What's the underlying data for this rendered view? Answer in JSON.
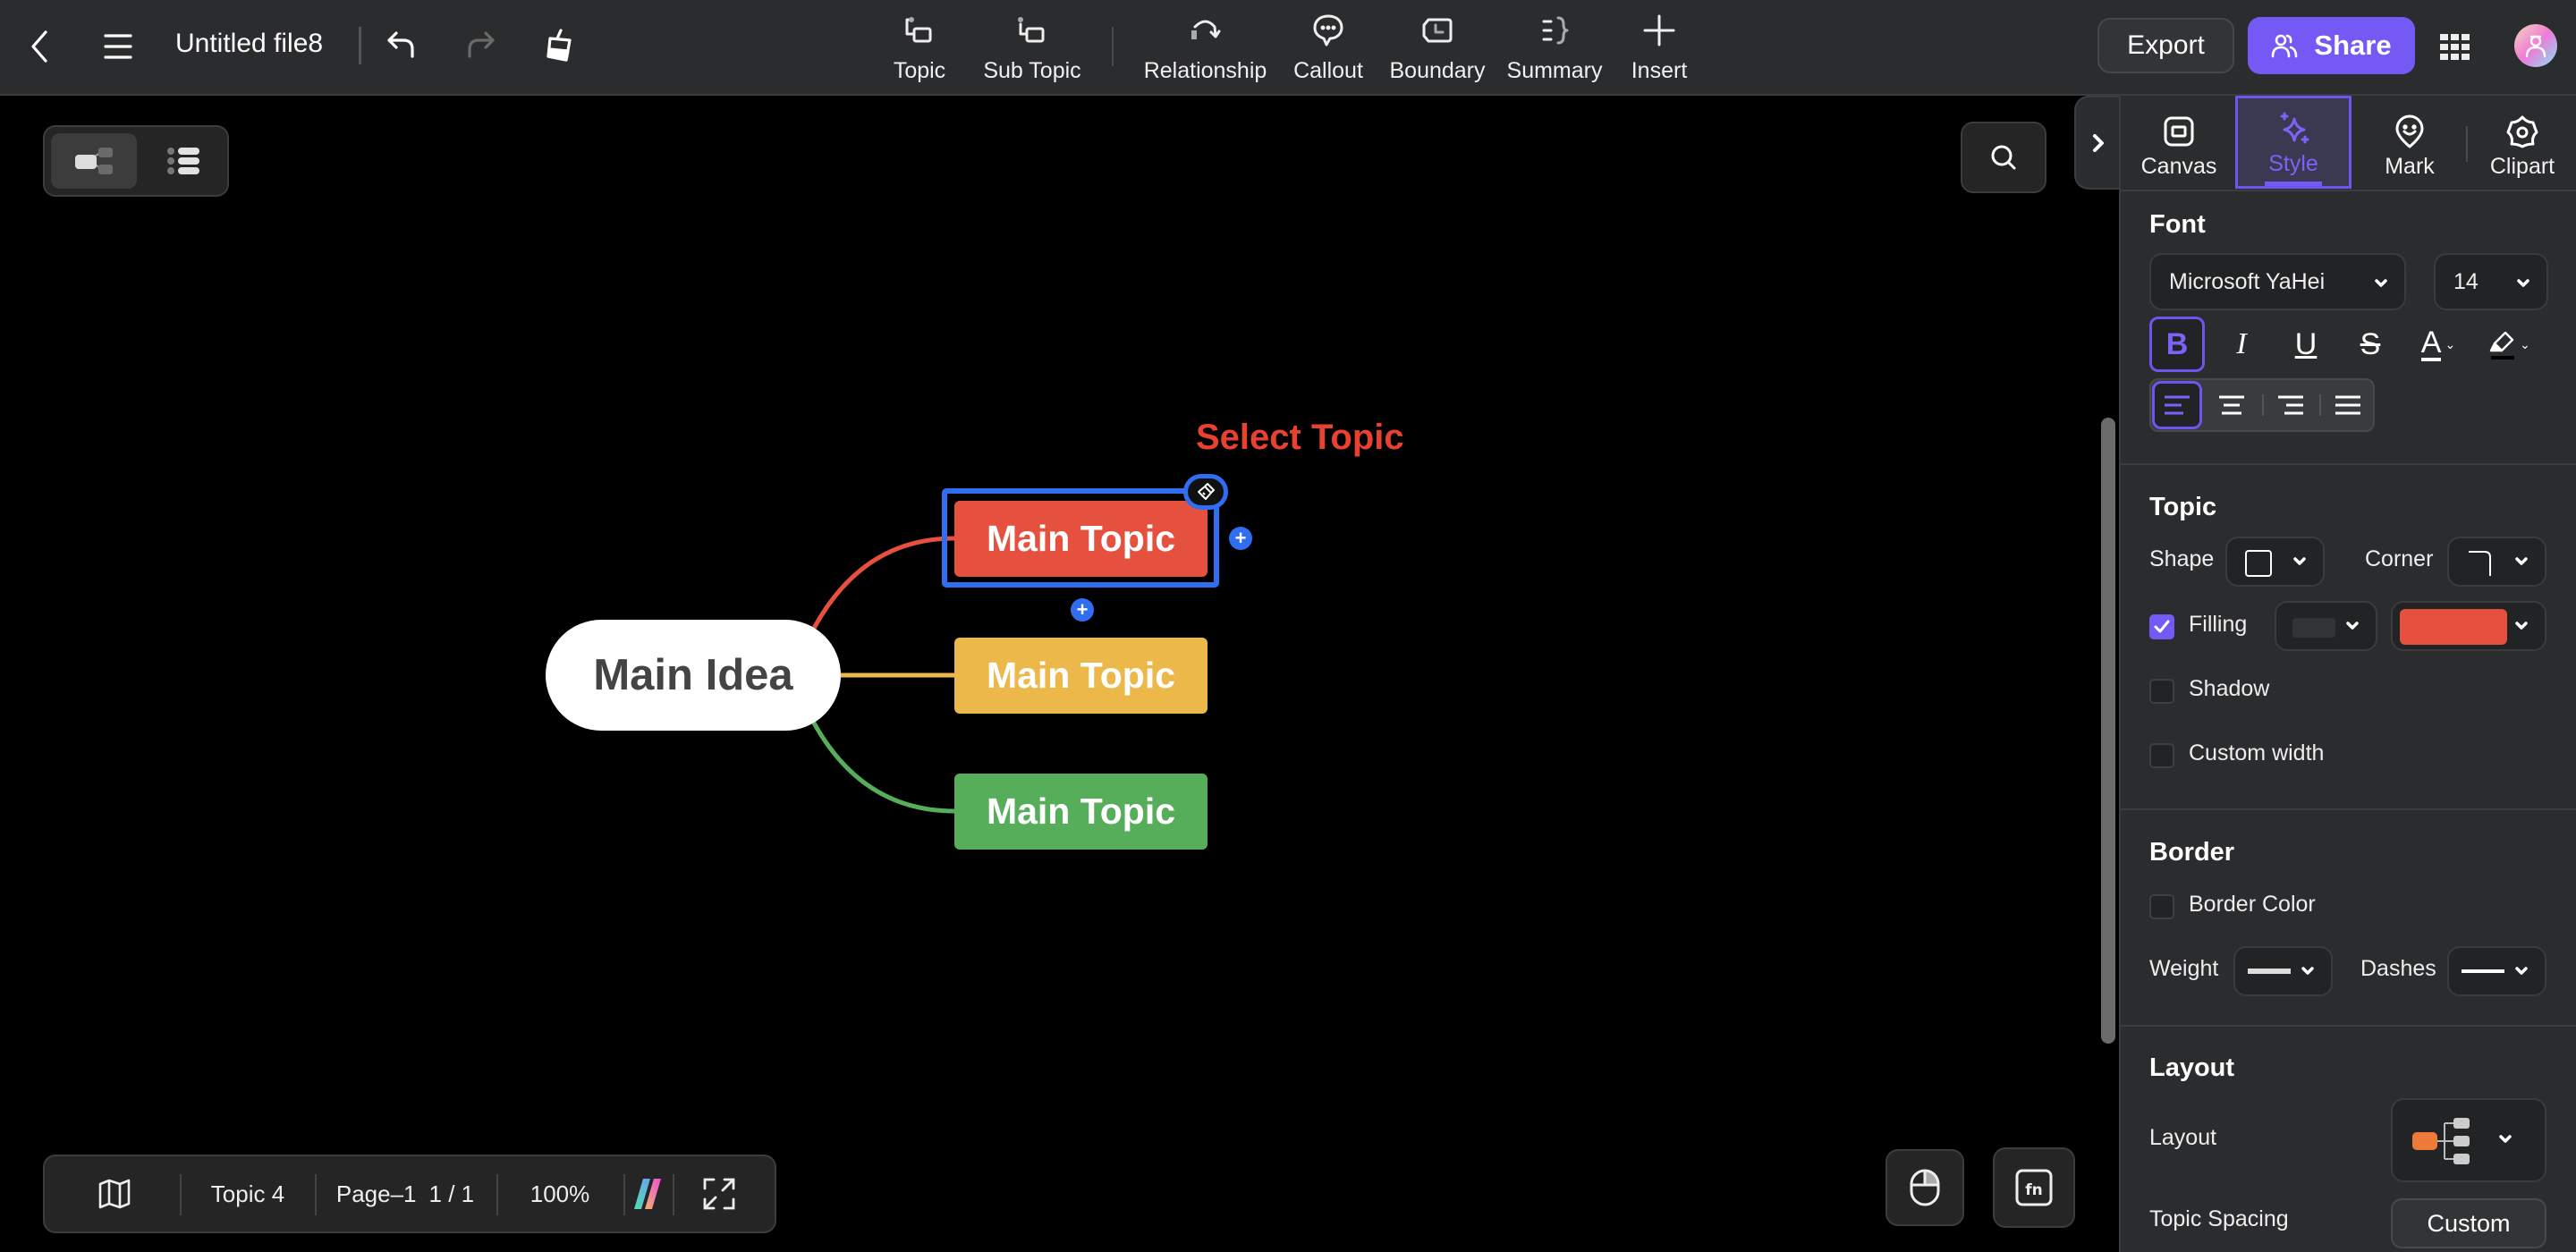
{
  "header": {
    "file_title": "Untitled file8",
    "icons": {
      "back": "chevron-left-icon",
      "menu": "hamburger-menu-icon",
      "undo": "undo-icon",
      "redo": "redo-icon",
      "format_painter": "format-painter-icon"
    },
    "tools": [
      {
        "label": "Topic",
        "icon": "topic-icon"
      },
      {
        "label": "Sub Topic",
        "icon": "subtopic-icon"
      },
      {
        "label": "Relationship",
        "icon": "relationship-icon"
      },
      {
        "label": "Callout",
        "icon": "callout-icon"
      },
      {
        "label": "Boundary",
        "icon": "boundary-icon"
      },
      {
        "label": "Summary",
        "icon": "summary-icon"
      },
      {
        "label": "Insert",
        "icon": "plus-icon"
      }
    ],
    "export_label": "Export",
    "share_label": "Share",
    "apps_icon": "grid-apps-icon",
    "avatar_icon": "user-avatar-icon"
  },
  "canvas": {
    "view_toggle": [
      "mindmap-view",
      "outline-view"
    ],
    "annotation": "Select Topic",
    "central_topic": "Main Idea",
    "topics": [
      {
        "label": "Main Topic",
        "color": "#e5503f",
        "selected": true
      },
      {
        "label": "Main Topic",
        "color": "#edb84a",
        "selected": false
      },
      {
        "label": "Main Topic",
        "color": "#56ae5a",
        "selected": false
      }
    ],
    "add_child_label": "+",
    "add_sibling_label": "+",
    "selection_color": "#2f6ef0"
  },
  "bottom_bar": {
    "map_icon": "map-icon",
    "topic_count": "Topic 4",
    "page": "Page–1",
    "page_index": "1 / 1",
    "zoom": "100%",
    "ai_icon": "ai-logo-icon",
    "fullscreen_icon": "fullscreen-icon"
  },
  "bottom_right": {
    "mouse_icon": "mouse-icon",
    "fn_icon": "fn-key-icon"
  },
  "panel": {
    "tabs": [
      {
        "label": "Canvas",
        "active": false
      },
      {
        "label": "Style",
        "active": true
      },
      {
        "label": "Mark",
        "active": false
      },
      {
        "label": "Clipart",
        "active": false
      }
    ],
    "font": {
      "title": "Font",
      "family": "Microsoft YaHei",
      "size": "14",
      "bold_active": true,
      "align_active": "left",
      "format_buttons": [
        "B",
        "I",
        "U",
        "S",
        "A"
      ]
    },
    "topic": {
      "title": "Topic",
      "shape_label": "Shape",
      "corner_label": "Corner",
      "filling_label": "Filling",
      "filling_checked": true,
      "fill_color": "#e5503f",
      "shadow_label": "Shadow",
      "shadow_checked": false,
      "custom_width_label": "Custom width",
      "custom_width_checked": false
    },
    "border": {
      "title": "Border",
      "border_color_label": "Border Color",
      "border_color_checked": false,
      "weight_label": "Weight",
      "dashes_label": "Dashes"
    },
    "layout": {
      "title": "Layout",
      "layout_label": "Layout",
      "topic_spacing_label": "Topic Spacing",
      "topic_spacing_button": "Custom"
    }
  }
}
